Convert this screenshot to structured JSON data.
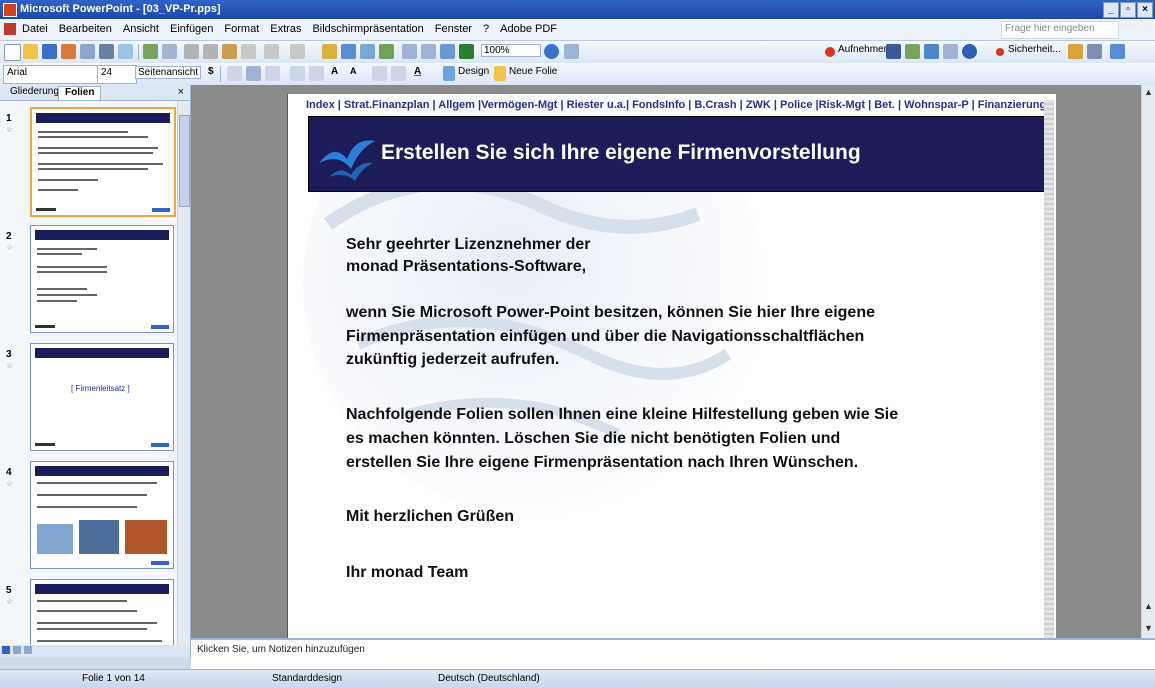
{
  "window": {
    "title": "Microsoft PowerPoint - [03_VP-Pr.pps]"
  },
  "menu": {
    "items": [
      "Datei",
      "Bearbeiten",
      "Ansicht",
      "Einfügen",
      "Format",
      "Extras",
      "Bildschirmpräsentation",
      "Fenster",
      "?",
      "Adobe PDF"
    ],
    "help_placeholder": "Frage hier eingeben"
  },
  "toolbar1": {
    "zoom": "100%",
    "right_labels": {
      "record": "Aufnehmen",
      "security": "Sicherheit..."
    }
  },
  "toolbar2": {
    "font": "Arial",
    "size": "24",
    "view_label": "Seitenansicht",
    "design_label": "Design",
    "new_slide_label": "Neue Folie"
  },
  "left_pane": {
    "tabs": [
      "Gliederung",
      "Folien"
    ],
    "close": "×",
    "thumbnails": [
      {
        "num": "1",
        "text": ""
      },
      {
        "num": "2",
        "text": ""
      },
      {
        "num": "3",
        "text": "[ Firmenleitsatz ]"
      },
      {
        "num": "4",
        "text": ""
      },
      {
        "num": "5",
        "text": ""
      }
    ]
  },
  "slide": {
    "nav_links": "Index | Strat.Finanzplan | Allgem |Vermögen-Mgt | Riester u.a.| FondsInfo | B.Crash | ZWK | Police |Risk-Mgt | Bet. | Wohnspar-P | Finanzierung | ?",
    "title": "Erstellen Sie sich Ihre eigene Firmenvorstellung",
    "greeting_line1": "Sehr geehrter Lizenznehmer der",
    "greeting_line2": "monad Präsentations-Software,",
    "para1_line1": "wenn Sie Microsoft Power-Point besitzen, können Sie hier Ihre eigene",
    "para1_line2": "Firmenpräsentation einfügen und über die Navigationsschaltflächen",
    "para1_line3": "zukünftig jederzeit aufrufen.",
    "para2_line1": "Nachfolgende Folien sollen Ihnen eine kleine Hilfestellung geben wie Sie",
    "para2_line2": "es machen könnten. Löschen Sie die nicht benötigten Folien und",
    "para2_line3": "erstellen Sie Ihre eigene Firmenpräsentation nach Ihren Wünschen.",
    "regards": "Mit herzlichen Grüßen",
    "signature": "Ihr monad Team"
  },
  "notes": {
    "placeholder": "Klicken Sie, um Notizen hinzuzufügen"
  },
  "status": {
    "slide": "Folie 1 von 14",
    "design": "Standarddesign",
    "language": "Deutsch (Deutschland)"
  },
  "colors": {
    "banner": "#1c1c58",
    "nav_link": "#2a2f8a",
    "titlebar": "#2f63c8"
  }
}
